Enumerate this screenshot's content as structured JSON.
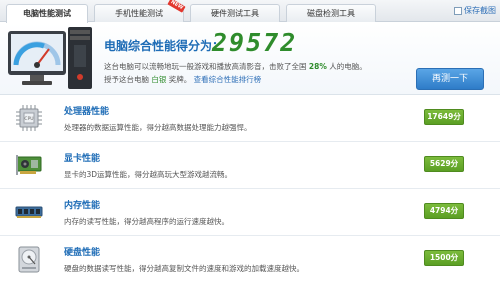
{
  "tabs": [
    {
      "label": "电脑性能测试",
      "active": true,
      "badge": ""
    },
    {
      "label": "手机性能测试",
      "active": false,
      "badge": "NEW"
    },
    {
      "label": "硬件测试工具",
      "active": false,
      "badge": ""
    },
    {
      "label": "磁盘检测工具",
      "active": false,
      "badge": ""
    }
  ],
  "save_link": "保存截图",
  "header": {
    "score_title": "电脑综合性能得分为：",
    "score_value": "29572",
    "desc_prefix": "这台电脑可以流畅地玩一般游戏和播放高清影音，击败了全国",
    "desc_percent": "28%",
    "desc_suffix": "人的电脑。",
    "rank_prefix": "授予这台电脑",
    "rank_level": "白银",
    "rank_middle": "奖牌。",
    "rank_link": "查看综合性能排行榜",
    "retest_button": "再测一下"
  },
  "rows": [
    {
      "title": "处理器性能",
      "desc": "处理器的数据运算性能，得分越高数据处理能力越强悍。",
      "score": "17649分",
      "icon": "cpu-icon"
    },
    {
      "title": "显卡性能",
      "desc": "显卡的3D运算性能，得分越高玩大型游戏越流畅。",
      "score": "5629分",
      "icon": "graphics-card-icon"
    },
    {
      "title": "内存性能",
      "desc": "内存的读写性能，得分越高程序的运行速度越快。",
      "score": "4794分",
      "icon": "memory-icon"
    },
    {
      "title": "硬盘性能",
      "desc": "硬盘的数据读写性能，得分越高复制文件的速度和游戏的加载速度越快。",
      "score": "1500分",
      "icon": "hard-disk-icon"
    }
  ],
  "colors": {
    "accent_blue": "#1e6cb6",
    "score_green": "#2f8c2c",
    "badge_green": "#5b9f24"
  }
}
